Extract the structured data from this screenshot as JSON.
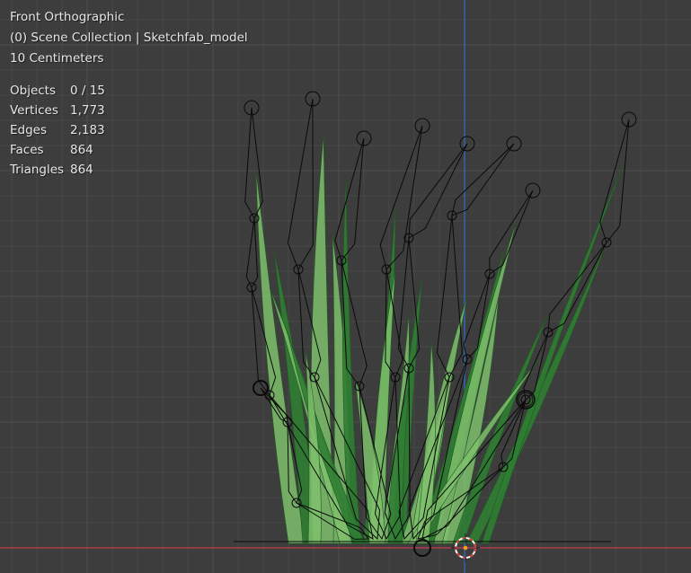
{
  "viewport": {
    "view_name": "Front Orthographic",
    "collection": "(0) Scene Collection | Sketchfab_model",
    "grid_scale": "10 Centimeters",
    "colors": {
      "background": "#3d3d3d",
      "grid_minor": "#464646",
      "grid_major": "#4e4e4e",
      "x_axis": "#c63c4b",
      "z_axis": "#2f6fc6",
      "grass_dark": "#2f7d33",
      "grass_light": "#7fbf6c",
      "armature_lines": "#0a0a0a",
      "cursor": "#d83a3a"
    },
    "icons": [
      "3d-cursor-icon",
      "origin-dot-icon"
    ]
  },
  "stats": {
    "rows": [
      {
        "label": "Objects",
        "value": "0 / 15"
      },
      {
        "label": "Vertices",
        "value": "1,773"
      },
      {
        "label": "Edges",
        "value": "2,183"
      },
      {
        "label": "Faces",
        "value": "864"
      },
      {
        "label": "Triangles",
        "value": "864"
      }
    ]
  }
}
